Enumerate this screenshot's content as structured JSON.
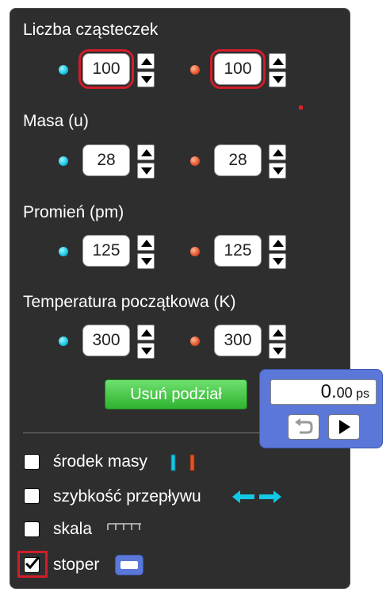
{
  "sections": {
    "particles": {
      "title": "Liczba cząsteczek",
      "left": "100",
      "right": "100"
    },
    "mass": {
      "title": "Masa (u)",
      "left": "28",
      "right": "28"
    },
    "radius": {
      "title": "Promień (pm)",
      "left": "125",
      "right": "125"
    },
    "temperature": {
      "title": "Temperatura początkowa (K)",
      "left": "300",
      "right": "300"
    }
  },
  "remove_divider_button": "Usuń podział",
  "checkboxes": [
    {
      "label": "środek masy",
      "checked": false
    },
    {
      "label": "szybkość przepływu",
      "checked": false
    },
    {
      "label": "skala",
      "checked": false
    },
    {
      "label": "stoper",
      "checked": true
    }
  ],
  "stopwatch": {
    "value": "0.",
    "decimals": "00",
    "unit": "ps"
  },
  "colors": {
    "panel": "#2e2e2e",
    "cyan": "#13c8e4",
    "orange": "#e5532a",
    "highlight": "#d11d2a",
    "button_green": "#2fb32f",
    "stopwatch_blue": "#5b78d8"
  }
}
